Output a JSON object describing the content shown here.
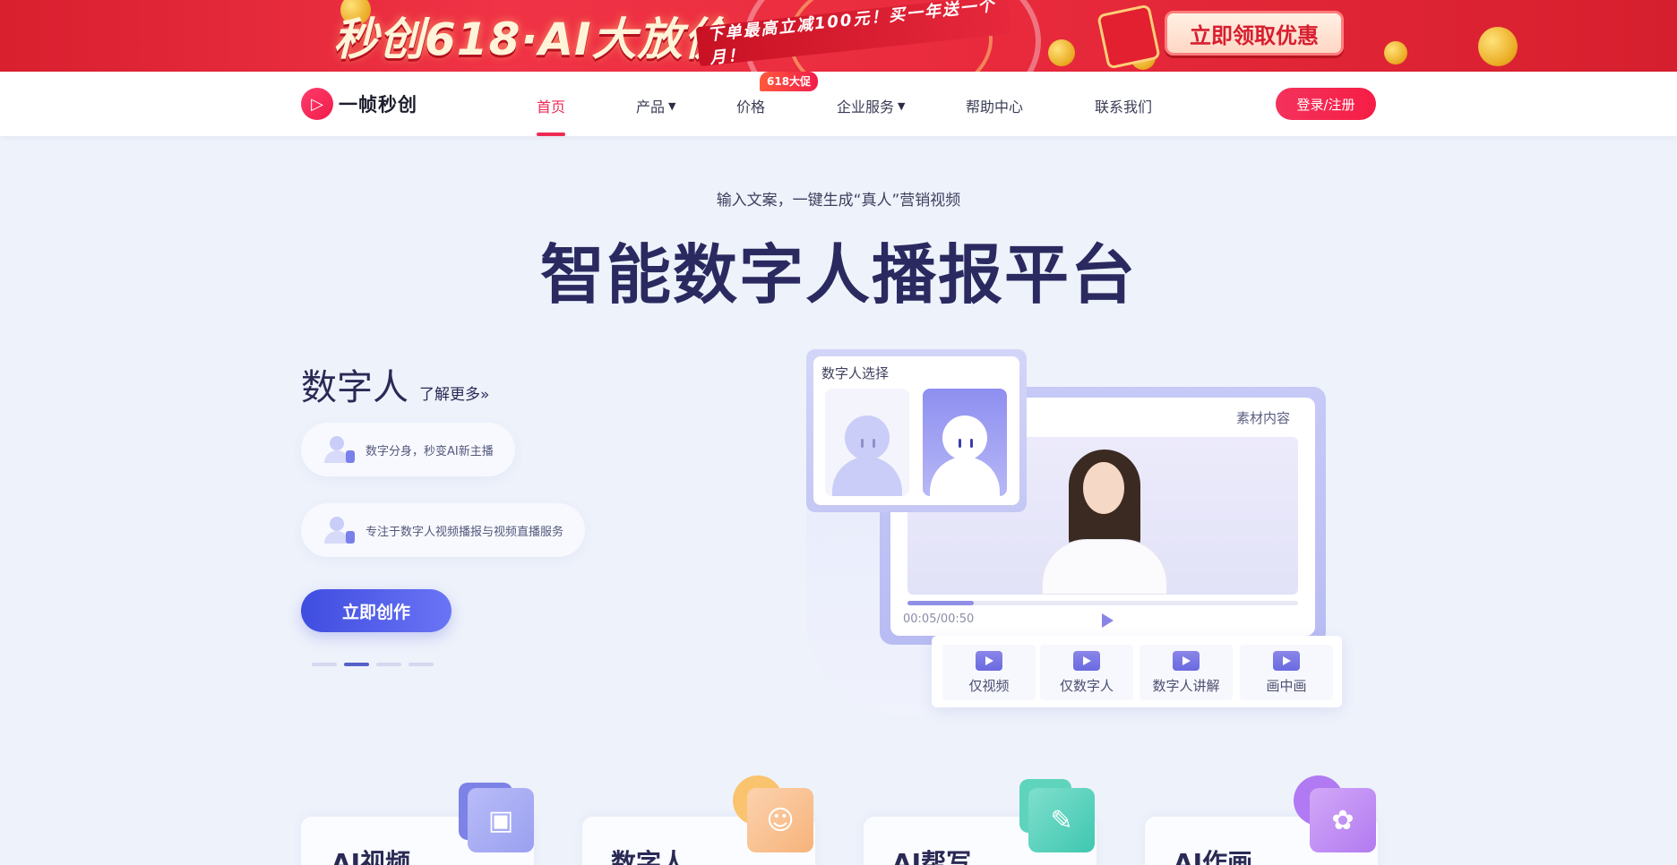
{
  "banner": {
    "title": "秒创618·AI大放价",
    "subtitle": "下单最高立减100元！买一年送一个月！",
    "cta": "立即领取优惠"
  },
  "nav": {
    "logo_text": "一帧秒创",
    "items": [
      {
        "label": "首页",
        "active": true
      },
      {
        "label": "产品",
        "dropdown": true
      },
      {
        "label": "价格",
        "badge": "618大促"
      },
      {
        "label": "企业服务",
        "dropdown": true
      },
      {
        "label": "帮助中心"
      },
      {
        "label": "联系我们"
      }
    ],
    "login": "登录/注册"
  },
  "hero": {
    "subtitle": "输入文案，一键生成“真人”营销视频",
    "title": "智能数字人播报平台"
  },
  "feature": {
    "title": "数字人",
    "more": "了解更多»",
    "pills": [
      "数字分身，秒变AI新主播",
      "专注于数字人视频播报与视频直播服务"
    ],
    "cta": "立即创作",
    "carousel_active": 2,
    "carousel_count": 4
  },
  "illustration": {
    "select_label": "数字人选择",
    "material_label": "素材内容",
    "time": "00:05/00:50",
    "progress": 0.17,
    "modes": [
      "仅视频",
      "仅数字人",
      "数字人讲解",
      "画中画"
    ]
  },
  "cards": [
    {
      "title": "AI视频",
      "color": "#8f95ee"
    },
    {
      "title": "数字人",
      "color": "#f6b37a"
    },
    {
      "title": "AI帮写",
      "color": "#3fc7b0"
    },
    {
      "title": "AI作画",
      "color": "#b27af0"
    }
  ],
  "colors": {
    "brand_red": "#ef2b55",
    "hero_title": "#2a2a60",
    "primary_blue": "#4654e6"
  }
}
